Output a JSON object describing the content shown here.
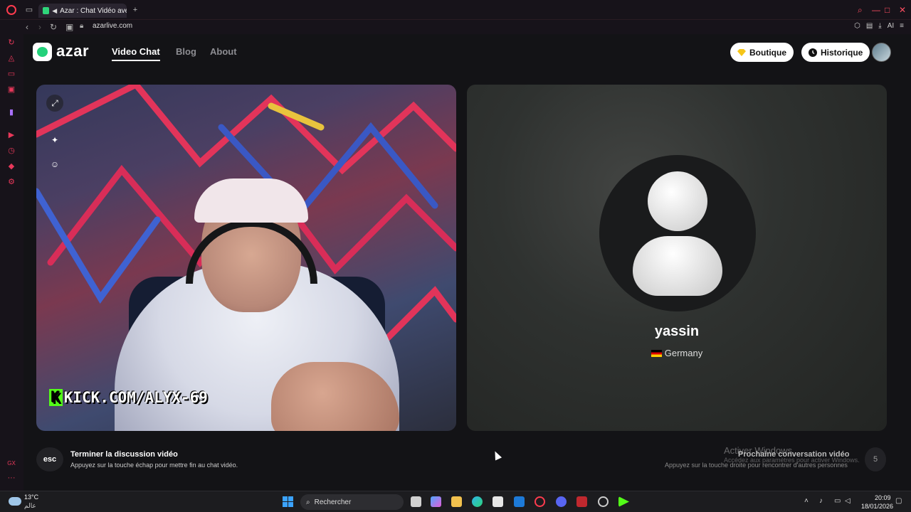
{
  "browser": {
    "tab_title": "Azar : Chat Vidéo avec",
    "url": "azarlive.com",
    "ai_label": "AI"
  },
  "header": {
    "logo": "azar",
    "nav": [
      "Video Chat",
      "Blog",
      "About"
    ],
    "shop_label": "Boutique",
    "history_label": "Historique"
  },
  "stream_overlay": {
    "kick_letter": "K",
    "text": "KICK.COM/ALYX-69"
  },
  "peer": {
    "name": "yassin",
    "country": "Germany"
  },
  "hints": {
    "esc_key": "esc",
    "end_title": "Terminer la discussion vidéo",
    "end_sub": "Appuyez sur la touche échap pour mettre fin au chat vidéo.",
    "next_title": "Prochaine conversation vidéo",
    "next_sub": "Appuyez sur la touche droite pour rencontrer d'autres personnes",
    "next_key": "5"
  },
  "watermark": {
    "line1": "Activer Windows",
    "line2": "Accédez aux paramètres pour activer Windows."
  },
  "taskbar": {
    "temperature": "13°C",
    "condition": "عالم",
    "search_placeholder": "Rechercher",
    "time": "20:09",
    "date": "18/01/2026"
  },
  "colors": {
    "accent": "#23d17a",
    "opera_red": "#ff3b4e",
    "kick_green": "#53fc18"
  }
}
